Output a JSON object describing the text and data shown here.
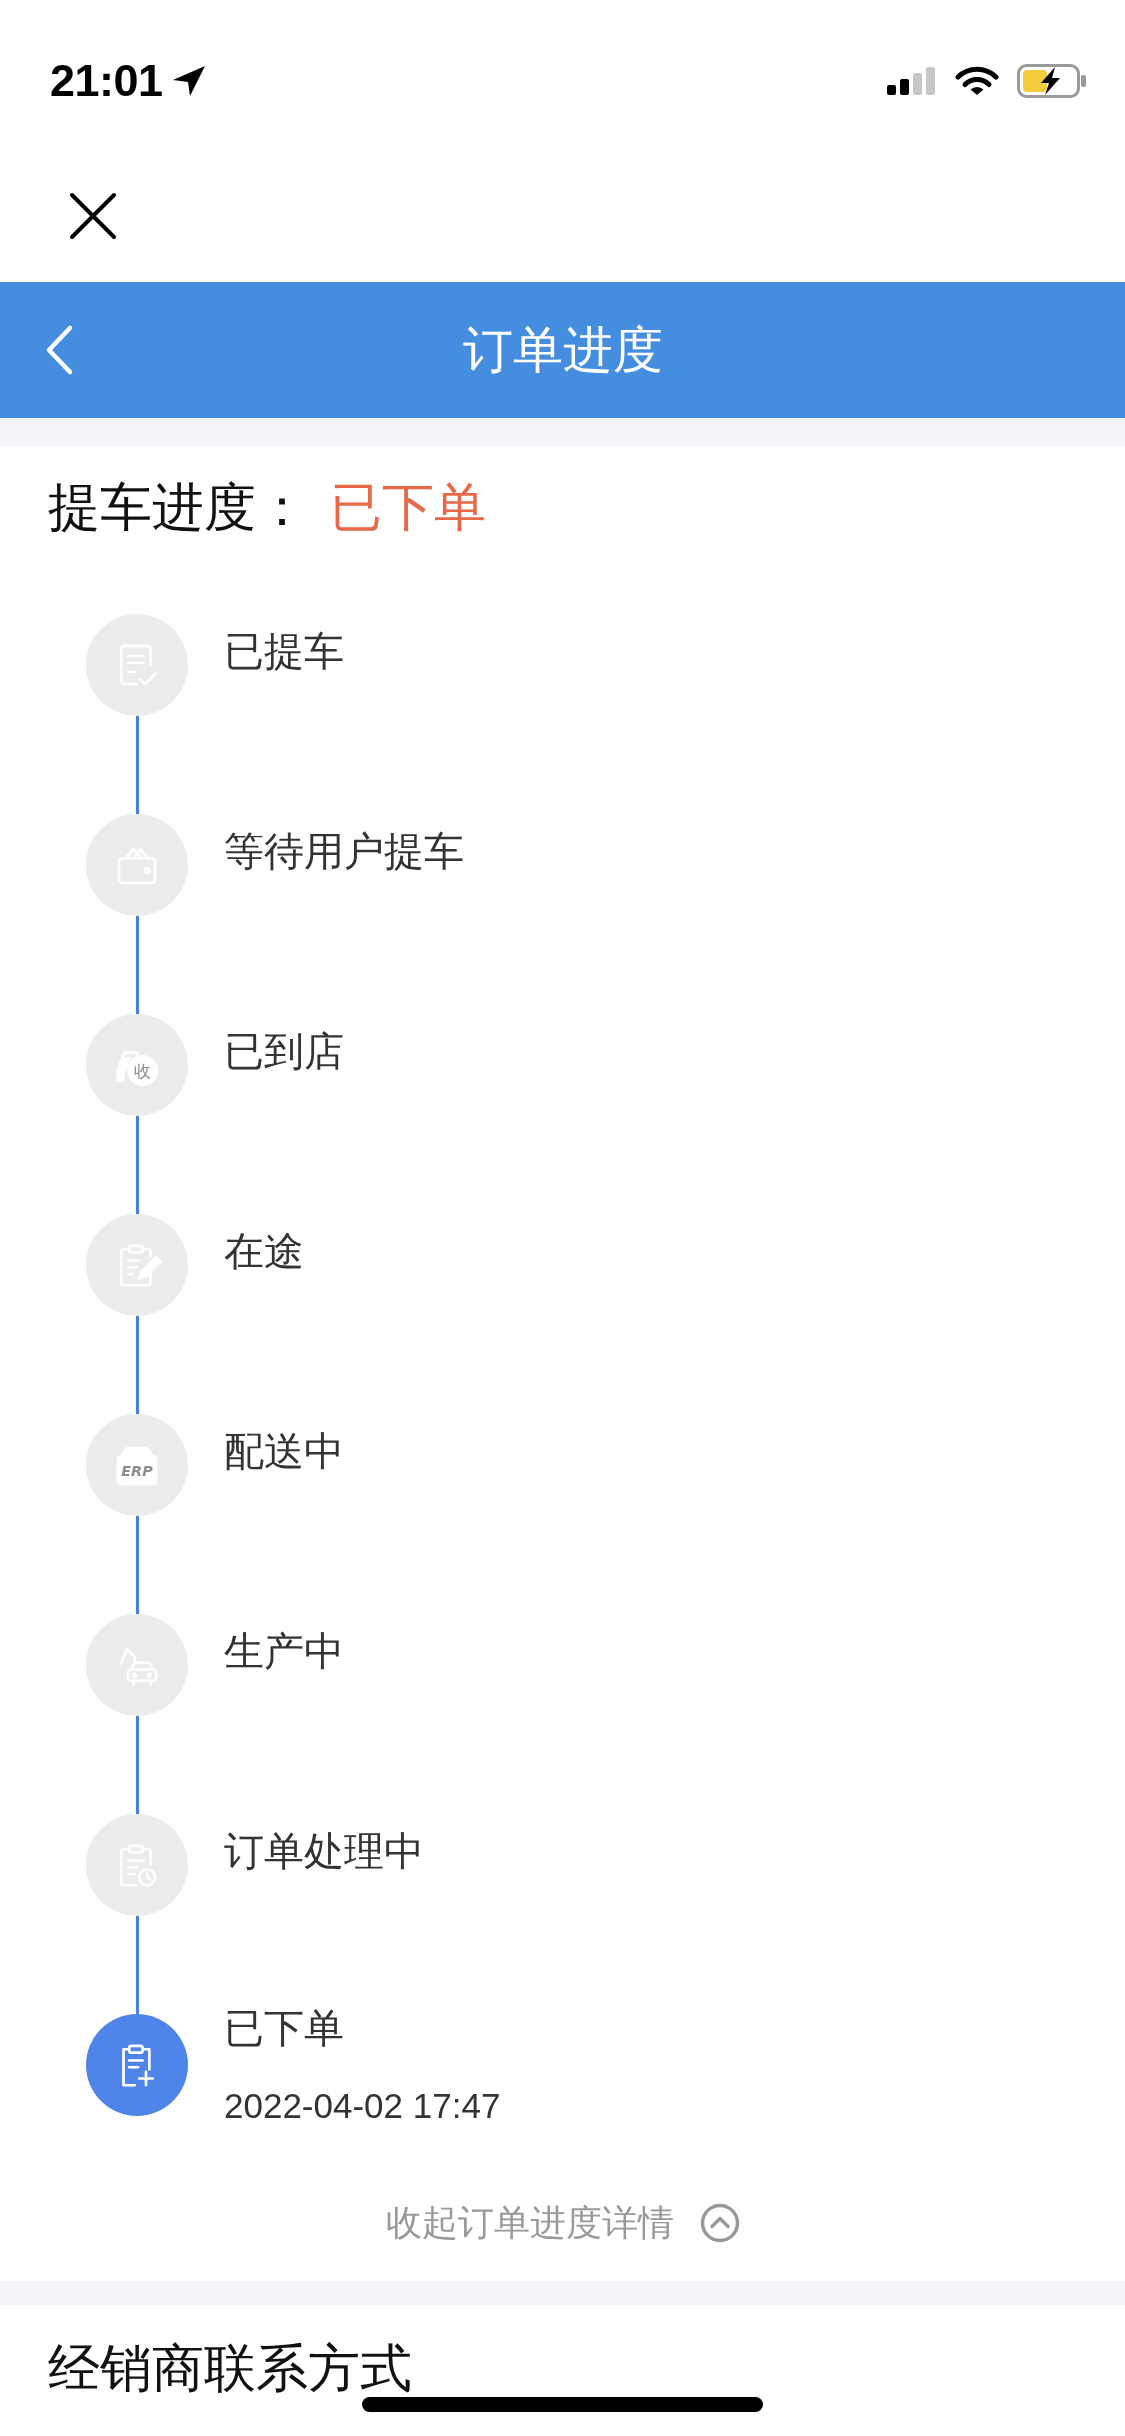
{
  "status_bar": {
    "time": "21:01"
  },
  "nav_bar": {
    "title": "订单进度"
  },
  "pickup_progress": {
    "label": "提车进度：",
    "status": "已下单"
  },
  "timeline": {
    "steps": [
      {
        "kind": "checklist",
        "label": "已提车",
        "active": false
      },
      {
        "kind": "wallet",
        "label": "等待用户提车",
        "active": false
      },
      {
        "kind": "car",
        "label": "已到店",
        "active": false,
        "icon_text": "收"
      },
      {
        "kind": "pencil",
        "label": "在途",
        "active": false
      },
      {
        "kind": "box",
        "label": "配送中",
        "active": false,
        "icon_text": "ERP"
      },
      {
        "kind": "crane",
        "label": "生产中",
        "active": false
      },
      {
        "kind": "clock",
        "label": "订单处理中",
        "active": false
      },
      {
        "kind": "plus",
        "label": "已下单",
        "active": true,
        "time": "2022-04-02 17:47"
      }
    ],
    "collapse_label": "收起订单进度详情"
  },
  "dealer_contact": {
    "title": "经销商联系方式"
  }
}
